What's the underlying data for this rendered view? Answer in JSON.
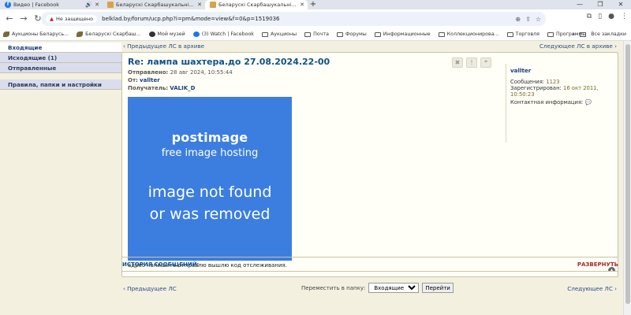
{
  "browser": {
    "tabs": [
      {
        "title": "Видео | Facebook",
        "icon": "facebook-icon",
        "extra": "speaker-icon"
      },
      {
        "title": "Беларускі Скарбашукальніцкі",
        "icon": "site-icon",
        "extra": ""
      },
      {
        "title": "Беларускі Скарбашукальніцкі",
        "icon": "site-icon",
        "extra": ""
      }
    ],
    "security_label": "Не защищено",
    "url": "belklad.by/forum/ucp.php?i=pm&mode=view&f=0&p=1519036",
    "bookmarks": [
      {
        "label": "Аукционы Беларусь...",
        "icon": "leaf"
      },
      {
        "label": "Беларускі Скарбаш...",
        "icon": "leaf"
      },
      {
        "label": "Мой музей",
        "icon": "gh"
      },
      {
        "label": "(3) Watch | Facebook",
        "icon": "fb"
      },
      {
        "label": "Аукционы",
        "icon": "folder"
      },
      {
        "label": "Почта",
        "icon": "folder"
      },
      {
        "label": "Форумы",
        "icon": "folder"
      },
      {
        "label": "Информационные",
        "icon": "folder"
      },
      {
        "label": "Коллекционирова...",
        "icon": "folder"
      },
      {
        "label": "Торговля",
        "icon": "folder"
      },
      {
        "label": "Программы",
        "icon": "folder"
      }
    ],
    "all_bookmarks": "Все закладки"
  },
  "sidebar": {
    "items": [
      {
        "label": "Входящие"
      },
      {
        "label": "Исходящие (1)"
      },
      {
        "label": "Отправленные"
      },
      {
        "label": "Правила, папки и настройки"
      }
    ]
  },
  "message": {
    "prev_archive": "‹ Предыдущее ЛС в архиве",
    "next_archive": "Следующее ЛС в архиве ›",
    "subject": "Re: лампа шахтера.до 27.08.2024.22-00",
    "sent_label": "Отправлено:",
    "sent_value": "28 авг 2024, 10:55:44",
    "from_label": "От:",
    "from_value": "vallter",
    "to_label": "Получатель:",
    "to_value": "VALIK_D",
    "image": {
      "brand": "postimage",
      "tagline": "free image hosting",
      "error_line1": "image not found",
      "error_line2": "or was removed"
    },
    "body": "адрес напишите.отправлю вышлю код отслеживания."
  },
  "author": {
    "name": "vallter",
    "posts_label": "Сообщения:",
    "posts_value": "1123",
    "registered_label": "Зарегистрирован:",
    "registered_value": "16 окт 2011,",
    "registered_time": "10:50:23",
    "contact_label": "Контактная информация:"
  },
  "footer": {
    "prev": "‹ Предыдущее ЛС",
    "next": "Следующее ЛС ›",
    "move_label": "Переместить в папку:",
    "folder_selected": "Входящие",
    "go_button": "Перейти",
    "history_title": "ИСТОРИЯ СООБЩЕНИЙ:",
    "expand": "РАЗВЕРНУТЬ"
  }
}
